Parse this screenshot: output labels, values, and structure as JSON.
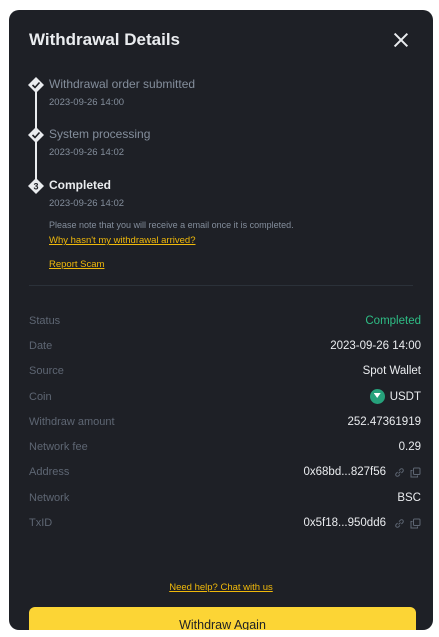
{
  "dialog": {
    "title": "Withdrawal Details"
  },
  "timeline": {
    "steps": [
      {
        "title": "Withdrawal order submitted",
        "time": "2023-09-26 14:00",
        "status": "done"
      },
      {
        "title": "System processing",
        "time": "2023-09-26 14:02",
        "status": "done"
      },
      {
        "title": "Completed",
        "number": "3",
        "time": "2023-09-26 14:02",
        "status": "current"
      }
    ],
    "note": "Please note that you will receive a email once it is completed.",
    "why_link": "Why hasn't my withdrawal arrived?",
    "report_link": "Report Scam"
  },
  "details": {
    "status_label": "Status",
    "status_value": "Completed",
    "date_label": "Date",
    "date_value": "2023-09-26 14:00",
    "source_label": "Source",
    "source_value": "Spot Wallet",
    "coin_label": "Coin",
    "coin_value": "USDT",
    "amount_label": "Withdraw amount",
    "amount_value": "252.47361919",
    "fee_label": "Network fee",
    "fee_value": "0.29",
    "address_label": "Address",
    "address_value": "0x68bd...827f56",
    "network_label": "Network",
    "network_value": "BSC",
    "txid_label": "TxID",
    "txid_value": "0x5f18...950dd6"
  },
  "help_link": "Need help? Chat with us",
  "withdraw_again_label": "Withdraw Again",
  "colors": {
    "background": "#1e2026",
    "accent": "#fcd535",
    "link": "#f0b90b",
    "success": "#2ebd85",
    "muted": "#848e9c"
  },
  "icons": {
    "close": "close-icon",
    "check": "check-icon",
    "coin": "usdt-icon",
    "link": "external-link-icon",
    "copy": "copy-icon"
  }
}
